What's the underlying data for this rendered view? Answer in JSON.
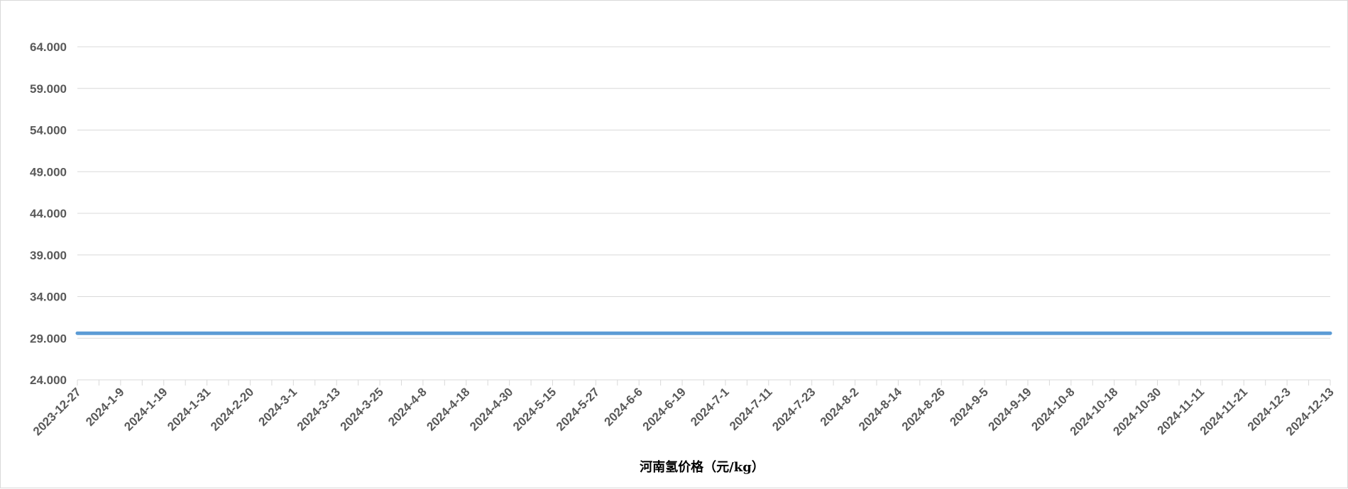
{
  "chart_data": {
    "type": "line",
    "title": "",
    "xlabel": "河南氢价格（元/kg）",
    "ylabel": "",
    "ylim": [
      24,
      64
    ],
    "y_ticks": [
      "24.000",
      "29.000",
      "34.000",
      "39.000",
      "44.000",
      "49.000",
      "54.000",
      "59.000",
      "64.000"
    ],
    "x_ticks": [
      "2023-12-27",
      "2024-1-9",
      "2024-1-19",
      "2024-1-31",
      "2024-2-20",
      "2024-3-1",
      "2024-3-13",
      "2024-3-25",
      "2024-4-8",
      "2024-4-18",
      "2024-4-30",
      "2024-5-15",
      "2024-5-27",
      "2024-6-6",
      "2024-6-19",
      "2024-7-1",
      "2024-7-11",
      "2024-7-23",
      "2024-8-2",
      "2024-8-14",
      "2024-8-26",
      "2024-9-5",
      "2024-9-19",
      "2024-10-8",
      "2024-10-18",
      "2024-10-30",
      "2024-11-11",
      "2024-11-21",
      "2024-12-3",
      "2024-12-13"
    ],
    "grid": true,
    "legend": "none",
    "series": [
      {
        "name": "",
        "color": "#5b9bd5",
        "x": [
          "2023-12-27",
          "2024-12-13"
        ],
        "values": [
          29.6,
          29.6
        ]
      }
    ]
  }
}
